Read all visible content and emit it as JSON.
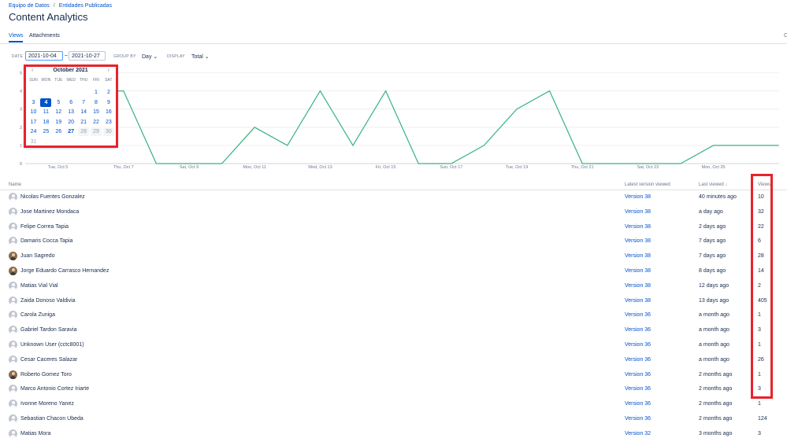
{
  "breadcrumb": {
    "items": [
      "Equipo de Datos",
      "Entidades Publicadas"
    ],
    "separator": "/"
  },
  "page": {
    "title": "Content Analytics"
  },
  "tabs": [
    {
      "label": "Views",
      "active": true
    },
    {
      "label": "Attachments",
      "active": false
    }
  ],
  "tab_right_glyph": "C",
  "filters": {
    "date_label": "DATE",
    "date_from": "2021-10-04",
    "date_sep": "–",
    "date_to": "2021-10-27",
    "group_by_label": "GROUP BY",
    "group_by_value": "Day",
    "display_label": "DISPLAY",
    "display_value": "Total",
    "chevron": "⌄"
  },
  "calendar": {
    "month_label": "October 2021",
    "prev": "‹",
    "next": "›",
    "weekdays": [
      "SUN",
      "MON",
      "TUE",
      "WED",
      "THU",
      "FRI",
      "SAT"
    ],
    "first_weekday_index": 5,
    "days_in_month": 31,
    "selected_day": 4,
    "today_day": 27,
    "disabled_days": [
      28,
      29,
      30
    ],
    "faded_days": [
      31
    ]
  },
  "chart_data": {
    "type": "line",
    "x_tick_labels": [
      "Tue, Oct 5",
      "Thu, Oct 7",
      "Sat, Oct 9",
      "Mon, Oct 11",
      "Wed, Oct 13",
      "Fri, Oct 15",
      "Sun, Oct 17",
      "Tue, Oct 19",
      "Thu, Oct 21",
      "Sat, Oct 23",
      "Mon, Oct 25"
    ],
    "x": [
      "Oct 4",
      "Oct 5",
      "Oct 6",
      "Oct 7",
      "Oct 8",
      "Oct 9",
      "Oct 10",
      "Oct 11",
      "Oct 12",
      "Oct 13",
      "Oct 14",
      "Oct 15",
      "Oct 16",
      "Oct 17",
      "Oct 18",
      "Oct 19",
      "Oct 20",
      "Oct 21",
      "Oct 22",
      "Oct 23",
      "Oct 24",
      "Oct 25",
      "Oct 26",
      "Oct 27"
    ],
    "values": [
      1,
      4,
      4,
      4,
      0,
      0,
      0,
      2,
      1,
      4,
      1,
      4,
      0,
      0,
      1,
      3,
      4,
      0,
      0,
      0,
      0,
      1,
      1,
      1
    ],
    "yticks": [
      0,
      1,
      2,
      3,
      4,
      5
    ],
    "ylim": [
      0,
      5
    ],
    "grid": "horizontal",
    "line_color": "#36b37e",
    "title": "",
    "xlabel": "",
    "ylabel": ""
  },
  "table": {
    "headers": {
      "name": "Name",
      "version": "Latest version viewed",
      "last_viewed": "Last viewed",
      "sort_glyph": "↓",
      "views": "Views"
    },
    "rows": [
      {
        "name": "Nicolas Fuentes Gonzalez",
        "version": "Version 38",
        "last_viewed": "40 minutes ago",
        "views": "10",
        "photo": false
      },
      {
        "name": "Jose Martinez Mondaca",
        "version": "Version 38",
        "last_viewed": "a day ago",
        "views": "32",
        "photo": false
      },
      {
        "name": "Felipe Correa Tapia",
        "version": "Version 38",
        "last_viewed": "2 days ago",
        "views": "22",
        "photo": false
      },
      {
        "name": "Damaris Cocca Tapia",
        "version": "Version 38",
        "last_viewed": "7 days ago",
        "views": "6",
        "photo": false
      },
      {
        "name": "Juan Sagredo",
        "version": "Version 38",
        "last_viewed": "7 days ago",
        "views": "28",
        "photo": true
      },
      {
        "name": "Jorge Eduardo Carrasco Hernandez",
        "version": "Version 38",
        "last_viewed": "8 days ago",
        "views": "14",
        "photo": true
      },
      {
        "name": "Matias Vial Vial",
        "version": "Version 38",
        "last_viewed": "12 days ago",
        "views": "2",
        "photo": false
      },
      {
        "name": "Zaida Donoso Valdivia",
        "version": "Version 38",
        "last_viewed": "13 days ago",
        "views": "405",
        "photo": false
      },
      {
        "name": "Carola Zuniga",
        "version": "Version 36",
        "last_viewed": "a month ago",
        "views": "1",
        "photo": false
      },
      {
        "name": "Gabriel Tardon Saravia",
        "version": "Version 36",
        "last_viewed": "a month ago",
        "views": "3",
        "photo": false
      },
      {
        "name": "Unknown User (cctc8001)",
        "version": "Version 36",
        "last_viewed": "a month ago",
        "views": "1",
        "photo": false
      },
      {
        "name": "Cesar Caceres Salazar",
        "version": "Version 36",
        "last_viewed": "a month ago",
        "views": "26",
        "photo": false
      },
      {
        "name": "Roberto Gomez Toro",
        "version": "Version 36",
        "last_viewed": "2 months ago",
        "views": "1",
        "photo": true
      },
      {
        "name": "Marco Antonio Cortez Iriarte",
        "version": "Version 36",
        "last_viewed": "2 months ago",
        "views": "3",
        "photo": false
      },
      {
        "name": "Ivonne Moreno Yanez",
        "version": "Version 36",
        "last_viewed": "2 months ago",
        "views": "1",
        "photo": false
      },
      {
        "name": "Sebastian Chacon Ubeda",
        "version": "Version 36",
        "last_viewed": "2 months ago",
        "views": "124",
        "photo": false
      },
      {
        "name": "Matias Mora",
        "version": "Version 32",
        "last_viewed": "3 months ago",
        "views": "3",
        "photo": false
      }
    ]
  },
  "colors": {
    "accent": "#0052cc",
    "highlight": "#e8222c",
    "line": "#36b37e"
  }
}
